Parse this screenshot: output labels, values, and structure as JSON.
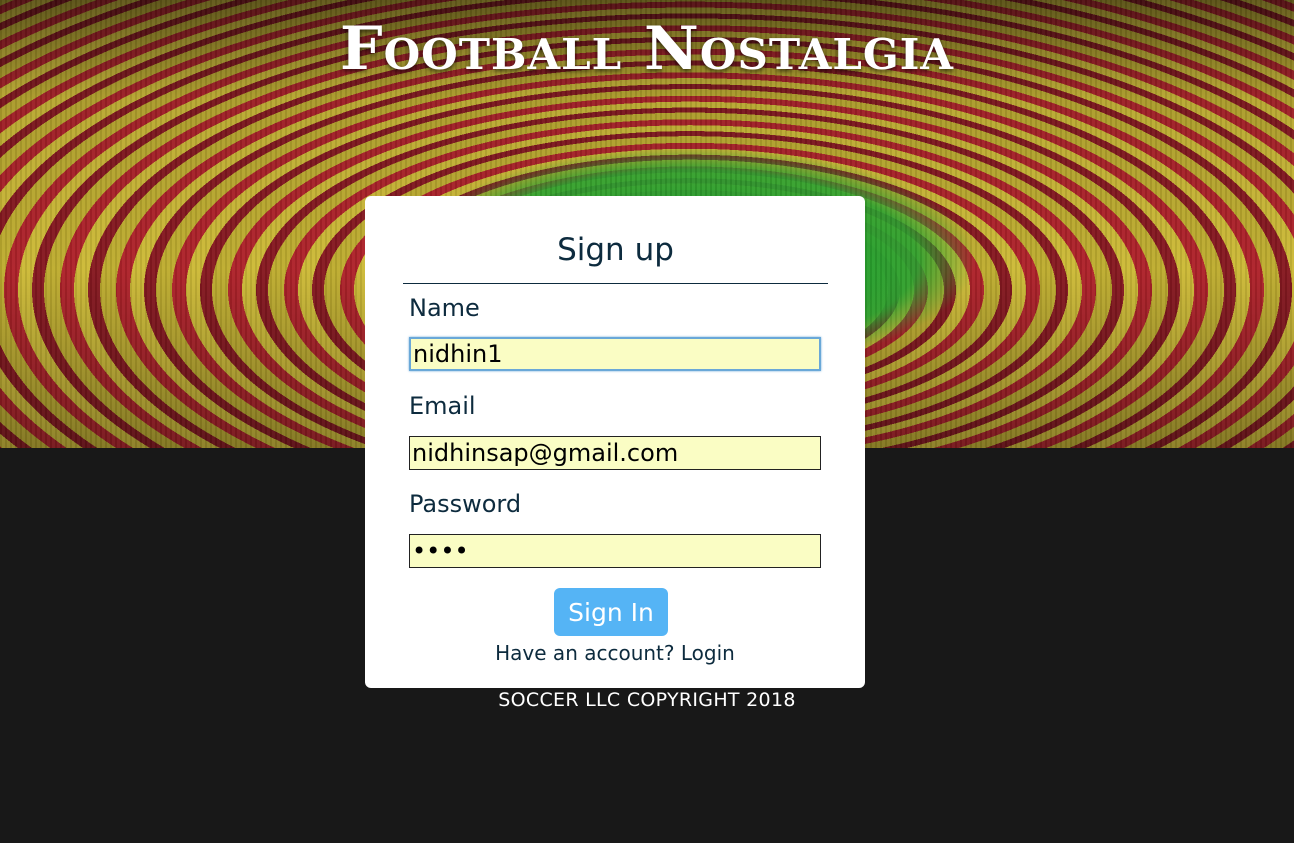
{
  "header": {
    "title": "Football Nostalgia"
  },
  "form": {
    "title": "Sign up",
    "name_label": "Name",
    "name_value": "nidhin1",
    "email_label": "Email",
    "email_value": "nidhinsap@gmail.com",
    "password_label": "Password",
    "password_value": "1234",
    "submit_label": "Sign In",
    "account_prompt": "Have an account?",
    "login_link": "Login"
  },
  "footer": {
    "text": "SOCCER LLC COPYRIGHT 2018"
  },
  "colors": {
    "page_background": "#181818",
    "card_background": "#ffffff",
    "text_dark": "#0d2b3e",
    "input_fill": "#fafdc4",
    "button": "#55b4f5",
    "focus_ring": "#6aa8d8"
  }
}
